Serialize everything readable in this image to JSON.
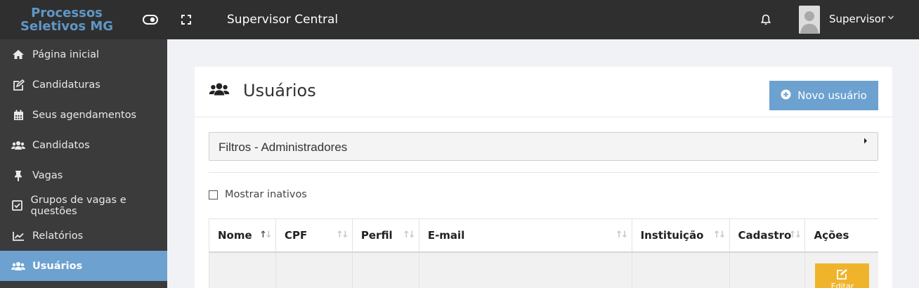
{
  "app": {
    "logo_line1": "Processos",
    "logo_line2": "Seletivos MG",
    "header_title": "Supervisor Central",
    "user_name": "Supervisor",
    "icons": [
      "toggle-icon",
      "fullscreen-icon",
      "bell-icon",
      "avatar",
      "chevron-down-icon"
    ]
  },
  "sidebar": {
    "items": [
      {
        "label": "Página inicial",
        "icon": "home-icon"
      },
      {
        "label": "Candidaturas",
        "icon": "edit-icon"
      },
      {
        "label": "Seus agendamentos",
        "icon": "calendar-icon"
      },
      {
        "label": "Candidatos",
        "icon": "users-icon"
      },
      {
        "label": "Vagas",
        "icon": "pin-icon"
      },
      {
        "label": "Grupos de vagas e questões",
        "icon": "check-square-icon"
      },
      {
        "label": "Relatórios",
        "icon": "chart-line-icon"
      },
      {
        "label": "Usuários",
        "icon": "users-icon",
        "active": true
      }
    ]
  },
  "page": {
    "title": "Usuários",
    "new_button": "Novo usuário",
    "filters_label": "Filtros - Administradores",
    "show_inactive_label": "Mostrar inativos",
    "show_inactive_checked": false
  },
  "table": {
    "columns": [
      "Nome",
      "CPF",
      "Perfil",
      "E-mail",
      "Instituição",
      "Cadastro",
      "Ações"
    ],
    "sorted_column": "Nome",
    "row_action_label": "Editar"
  },
  "colors": {
    "topbar": "#2f2f2f",
    "sidebar": "#3b3b3b",
    "accent": "#6ca1d0",
    "edit_button": "#f0b42c"
  }
}
